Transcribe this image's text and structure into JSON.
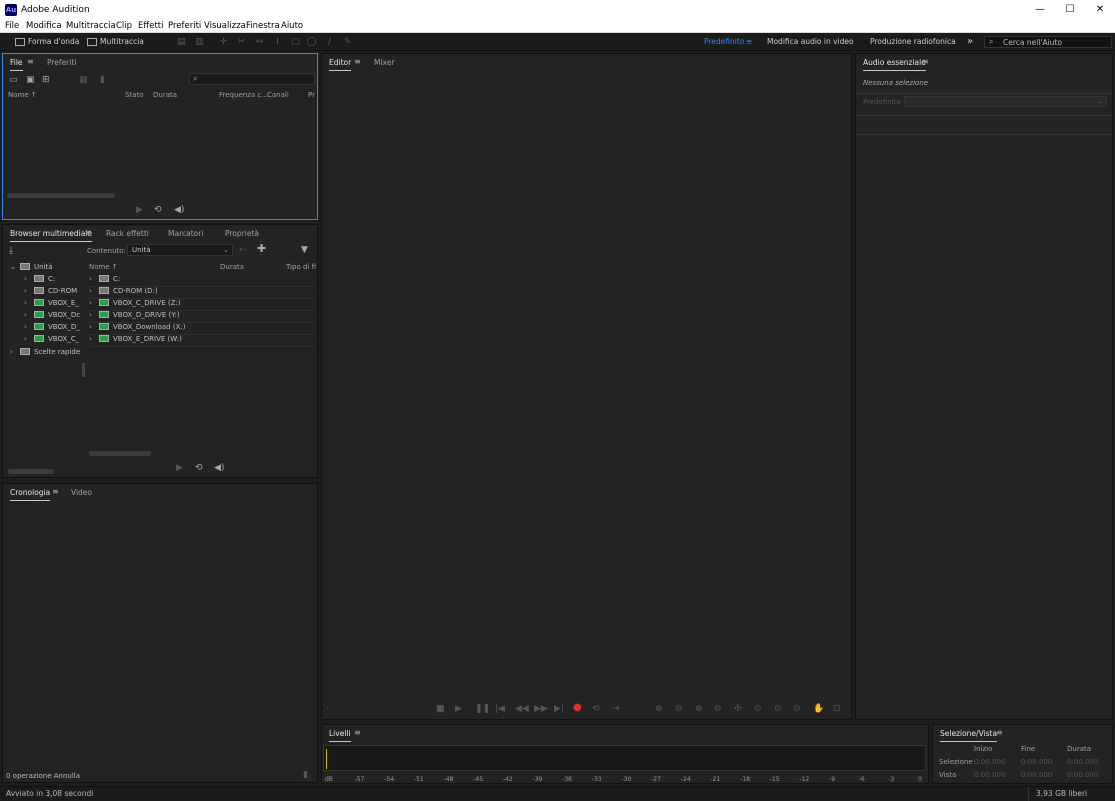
{
  "window": {
    "title": "Adobe Audition",
    "app_badge": "Au",
    "minimize": "—",
    "maximize": "☐",
    "close": "✕"
  },
  "menu": [
    "File",
    "Modifica",
    "Multitraccia",
    "Clip",
    "Effetti",
    "Preferiti",
    "Visualizza",
    "Finestra",
    "Aiuto"
  ],
  "toolbar": {
    "waveform": "Forma d'onda",
    "multitrack": "Multitraccia",
    "workspaces": [
      "Predefinito",
      "Modifica audio in video",
      "Produzione radiofonica"
    ],
    "more": "»",
    "search_placeholder": "Cerca nell'Aiuto",
    "accent": "#2d8ceb"
  },
  "files": {
    "tabs": [
      "File",
      "Preferiti"
    ],
    "columns": [
      "Nome ↑",
      "Stato",
      "Durata",
      "Frequenza c...",
      "Canali",
      "Pr"
    ]
  },
  "media": {
    "tabs": [
      "Browser multimediale",
      "Rack effetti",
      "Marcatori",
      "Proprietà"
    ],
    "content_label": "Contenuto:",
    "content_value": "Unità",
    "tree": [
      "Unità",
      "C:",
      "CD-ROM",
      "VBOX_E_",
      "VBOX_Dc",
      "VBOX_D_",
      "VBOX_C_",
      "Scelte rapide"
    ],
    "columns": [
      "Nome ↑",
      "Durata",
      "Tipo di fi"
    ],
    "items": [
      "C:",
      "CD-ROM (D:)",
      "VBOX_C_DRIVE (Z:)",
      "VBOX_D_DRIVE (Y:)",
      "VBOX_Download (X:)",
      "VBOX_E_DRIVE (W:)"
    ]
  },
  "history": {
    "tabs": [
      "Cronologia",
      "Video"
    ],
    "footer": "0 operazione Annulla"
  },
  "editor": {
    "tabs": [
      "Editor",
      "Mixer"
    ]
  },
  "essential": {
    "title": "Audio essenziale",
    "no_selection": "Nessuna selezione",
    "preset_label": "Predefinito"
  },
  "levels": {
    "title": "Livelli",
    "ticks": [
      "dB",
      "-57",
      "-54",
      "-51",
      "-48",
      "-45",
      "-42",
      "-39",
      "-36",
      "-33",
      "-30",
      "-27",
      "-24",
      "-21",
      "-18",
      "-15",
      "-12",
      "-9",
      "-6",
      "-3",
      "0"
    ]
  },
  "selection": {
    "title": "Selezione/Vista",
    "headers": [
      "Inizio",
      "Fine",
      "Durata"
    ],
    "rows": [
      {
        "label": "Selezione",
        "values": [
          "0:00.000",
          "0:00.000",
          "0:00.000"
        ]
      },
      {
        "label": "Vista",
        "values": [
          "0:00.000",
          "0:00.000",
          "0:00.000"
        ]
      }
    ]
  },
  "status": {
    "left": "Avviato in 3,08 secondi",
    "right": "3,93 GB liberi"
  }
}
